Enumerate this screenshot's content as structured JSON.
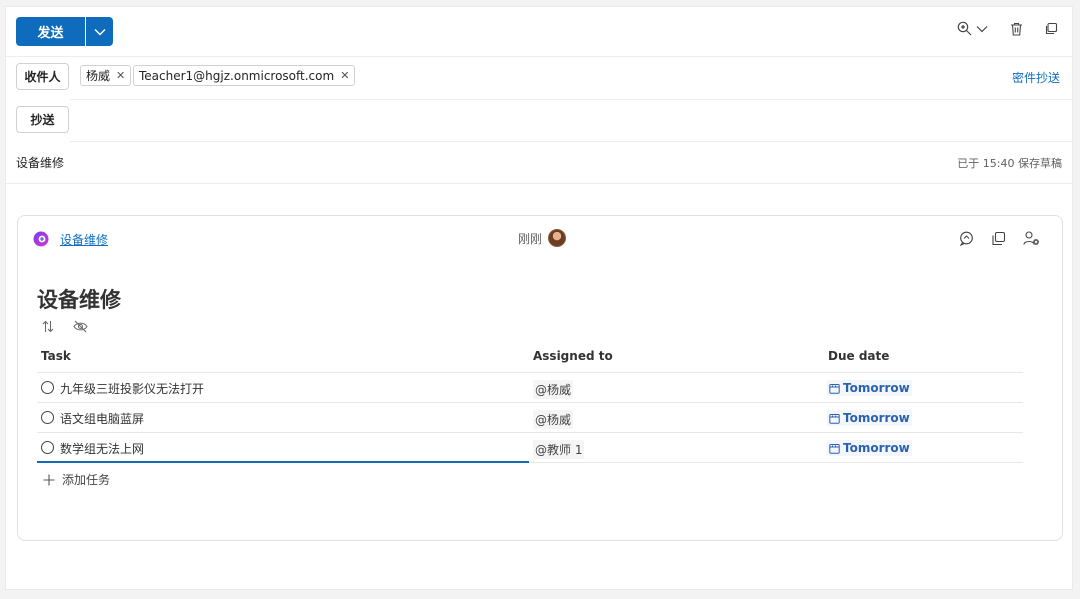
{
  "toolbar": {
    "send_label": "发送",
    "icons": [
      "zoom-in-icon",
      "chevron-down-icon",
      "delete-icon",
      "popout-icon"
    ]
  },
  "recipients": {
    "to_label": "收件人",
    "cc_label": "抄送",
    "bcc_link": "密件抄送",
    "to": [
      {
        "name": "杨威"
      },
      {
        "name": "Teacher1@hgjz.onmicrosoft.com"
      }
    ]
  },
  "subject": "设备维修",
  "saved_status": "已于 15:40 保存草稿",
  "loop": {
    "link_label": "设备维修",
    "presence_text": "刚刚",
    "title": "设备维修",
    "columns": {
      "task": "Task",
      "assigned": "Assigned to",
      "due": "Due date"
    },
    "rows": [
      {
        "task": "九年级三班投影仪无法打开",
        "assigned": "@杨威",
        "due": "Tomorrow"
      },
      {
        "task": "语文组电脑蓝屏",
        "assigned": "@杨威",
        "due": "Tomorrow"
      },
      {
        "task": "数学组无法上网",
        "assigned": "@教师 1",
        "due": "Tomorrow"
      }
    ],
    "add_task": "添加任务"
  },
  "colors": {
    "accent": "#0f6cbd",
    "due": "#2a62b0"
  }
}
